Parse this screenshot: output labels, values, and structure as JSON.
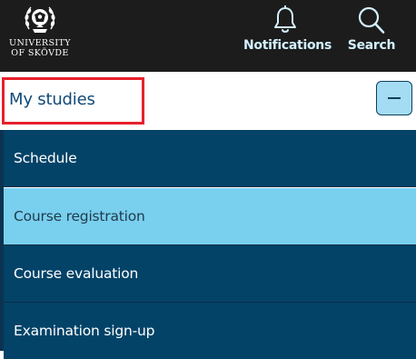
{
  "header": {
    "logo": {
      "line1": "UNIVERSITY",
      "line2": "OF SKÖVDE"
    },
    "actions": [
      {
        "label": "Notifications",
        "icon": "bell-icon"
      },
      {
        "label": "Search",
        "icon": "search-icon"
      }
    ]
  },
  "studies": {
    "title": "My studies",
    "toggle_icon": "minus-icon"
  },
  "menu": {
    "items": [
      {
        "label": "Schedule",
        "active": false
      },
      {
        "label": "Course registration",
        "active": true
      },
      {
        "label": "Course evaluation",
        "active": false
      },
      {
        "label": "Examination sign-up",
        "active": false
      }
    ]
  },
  "colors": {
    "topbar": "#1c1c1c",
    "menu_item": "#034368",
    "menu_item_active": "#79cfee",
    "highlight": "#e8202c",
    "title": "#114a78",
    "toggle_button": "#a3dcf3"
  }
}
